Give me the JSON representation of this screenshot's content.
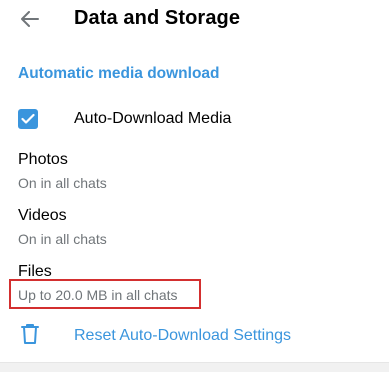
{
  "header": {
    "title": "Data and Storage",
    "back_icon": "arrow-left-icon"
  },
  "section": {
    "title": "Automatic media download"
  },
  "auto_download": {
    "label": "Auto-Download Media",
    "checked": true
  },
  "items": [
    {
      "title": "Photos",
      "subtitle": "On in all chats"
    },
    {
      "title": "Videos",
      "subtitle": "On in all chats"
    },
    {
      "title": "Files",
      "subtitle": "Up to 20.0 MB in all chats"
    }
  ],
  "reset": {
    "label": "Reset Auto-Download Settings",
    "icon": "trash-icon"
  },
  "colors": {
    "accent": "#3a95dd",
    "subtitle": "#707579",
    "highlight": "#d32f2f"
  }
}
